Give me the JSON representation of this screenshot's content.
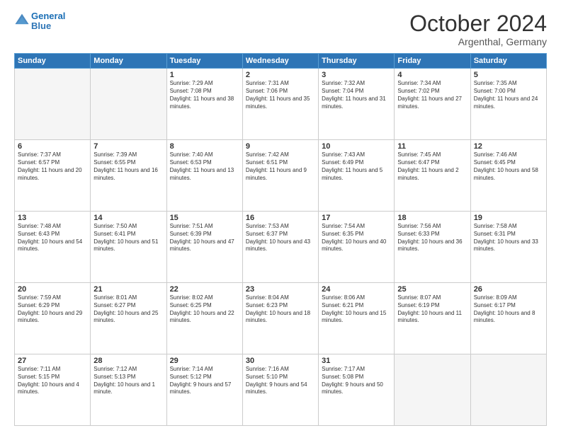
{
  "header": {
    "logo_line1": "General",
    "logo_line2": "Blue",
    "month": "October 2024",
    "location": "Argenthal, Germany"
  },
  "weekdays": [
    "Sunday",
    "Monday",
    "Tuesday",
    "Wednesday",
    "Thursday",
    "Friday",
    "Saturday"
  ],
  "weeks": [
    [
      {
        "day": "",
        "empty": true
      },
      {
        "day": "",
        "empty": true
      },
      {
        "day": "1",
        "sunrise": "Sunrise: 7:29 AM",
        "sunset": "Sunset: 7:08 PM",
        "daylight": "Daylight: 11 hours and 38 minutes."
      },
      {
        "day": "2",
        "sunrise": "Sunrise: 7:31 AM",
        "sunset": "Sunset: 7:06 PM",
        "daylight": "Daylight: 11 hours and 35 minutes."
      },
      {
        "day": "3",
        "sunrise": "Sunrise: 7:32 AM",
        "sunset": "Sunset: 7:04 PM",
        "daylight": "Daylight: 11 hours and 31 minutes."
      },
      {
        "day": "4",
        "sunrise": "Sunrise: 7:34 AM",
        "sunset": "Sunset: 7:02 PM",
        "daylight": "Daylight: 11 hours and 27 minutes."
      },
      {
        "day": "5",
        "sunrise": "Sunrise: 7:35 AM",
        "sunset": "Sunset: 7:00 PM",
        "daylight": "Daylight: 11 hours and 24 minutes."
      }
    ],
    [
      {
        "day": "6",
        "sunrise": "Sunrise: 7:37 AM",
        "sunset": "Sunset: 6:57 PM",
        "daylight": "Daylight: 11 hours and 20 minutes."
      },
      {
        "day": "7",
        "sunrise": "Sunrise: 7:39 AM",
        "sunset": "Sunset: 6:55 PM",
        "daylight": "Daylight: 11 hours and 16 minutes."
      },
      {
        "day": "8",
        "sunrise": "Sunrise: 7:40 AM",
        "sunset": "Sunset: 6:53 PM",
        "daylight": "Daylight: 11 hours and 13 minutes."
      },
      {
        "day": "9",
        "sunrise": "Sunrise: 7:42 AM",
        "sunset": "Sunset: 6:51 PM",
        "daylight": "Daylight: 11 hours and 9 minutes."
      },
      {
        "day": "10",
        "sunrise": "Sunrise: 7:43 AM",
        "sunset": "Sunset: 6:49 PM",
        "daylight": "Daylight: 11 hours and 5 minutes."
      },
      {
        "day": "11",
        "sunrise": "Sunrise: 7:45 AM",
        "sunset": "Sunset: 6:47 PM",
        "daylight": "Daylight: 11 hours and 2 minutes."
      },
      {
        "day": "12",
        "sunrise": "Sunrise: 7:46 AM",
        "sunset": "Sunset: 6:45 PM",
        "daylight": "Daylight: 10 hours and 58 minutes."
      }
    ],
    [
      {
        "day": "13",
        "sunrise": "Sunrise: 7:48 AM",
        "sunset": "Sunset: 6:43 PM",
        "daylight": "Daylight: 10 hours and 54 minutes."
      },
      {
        "day": "14",
        "sunrise": "Sunrise: 7:50 AM",
        "sunset": "Sunset: 6:41 PM",
        "daylight": "Daylight: 10 hours and 51 minutes."
      },
      {
        "day": "15",
        "sunrise": "Sunrise: 7:51 AM",
        "sunset": "Sunset: 6:39 PM",
        "daylight": "Daylight: 10 hours and 47 minutes."
      },
      {
        "day": "16",
        "sunrise": "Sunrise: 7:53 AM",
        "sunset": "Sunset: 6:37 PM",
        "daylight": "Daylight: 10 hours and 43 minutes."
      },
      {
        "day": "17",
        "sunrise": "Sunrise: 7:54 AM",
        "sunset": "Sunset: 6:35 PM",
        "daylight": "Daylight: 10 hours and 40 minutes."
      },
      {
        "day": "18",
        "sunrise": "Sunrise: 7:56 AM",
        "sunset": "Sunset: 6:33 PM",
        "daylight": "Daylight: 10 hours and 36 minutes."
      },
      {
        "day": "19",
        "sunrise": "Sunrise: 7:58 AM",
        "sunset": "Sunset: 6:31 PM",
        "daylight": "Daylight: 10 hours and 33 minutes."
      }
    ],
    [
      {
        "day": "20",
        "sunrise": "Sunrise: 7:59 AM",
        "sunset": "Sunset: 6:29 PM",
        "daylight": "Daylight: 10 hours and 29 minutes."
      },
      {
        "day": "21",
        "sunrise": "Sunrise: 8:01 AM",
        "sunset": "Sunset: 6:27 PM",
        "daylight": "Daylight: 10 hours and 25 minutes."
      },
      {
        "day": "22",
        "sunrise": "Sunrise: 8:02 AM",
        "sunset": "Sunset: 6:25 PM",
        "daylight": "Daylight: 10 hours and 22 minutes."
      },
      {
        "day": "23",
        "sunrise": "Sunrise: 8:04 AM",
        "sunset": "Sunset: 6:23 PM",
        "daylight": "Daylight: 10 hours and 18 minutes."
      },
      {
        "day": "24",
        "sunrise": "Sunrise: 8:06 AM",
        "sunset": "Sunset: 6:21 PM",
        "daylight": "Daylight: 10 hours and 15 minutes."
      },
      {
        "day": "25",
        "sunrise": "Sunrise: 8:07 AM",
        "sunset": "Sunset: 6:19 PM",
        "daylight": "Daylight: 10 hours and 11 minutes."
      },
      {
        "day": "26",
        "sunrise": "Sunrise: 8:09 AM",
        "sunset": "Sunset: 6:17 PM",
        "daylight": "Daylight: 10 hours and 8 minutes."
      }
    ],
    [
      {
        "day": "27",
        "sunrise": "Sunrise: 7:11 AM",
        "sunset": "Sunset: 5:15 PM",
        "daylight": "Daylight: 10 hours and 4 minutes."
      },
      {
        "day": "28",
        "sunrise": "Sunrise: 7:12 AM",
        "sunset": "Sunset: 5:13 PM",
        "daylight": "Daylight: 10 hours and 1 minute."
      },
      {
        "day": "29",
        "sunrise": "Sunrise: 7:14 AM",
        "sunset": "Sunset: 5:12 PM",
        "daylight": "Daylight: 9 hours and 57 minutes."
      },
      {
        "day": "30",
        "sunrise": "Sunrise: 7:16 AM",
        "sunset": "Sunset: 5:10 PM",
        "daylight": "Daylight: 9 hours and 54 minutes."
      },
      {
        "day": "31",
        "sunrise": "Sunrise: 7:17 AM",
        "sunset": "Sunset: 5:08 PM",
        "daylight": "Daylight: 9 hours and 50 minutes."
      },
      {
        "day": "",
        "empty": true
      },
      {
        "day": "",
        "empty": true
      }
    ]
  ]
}
